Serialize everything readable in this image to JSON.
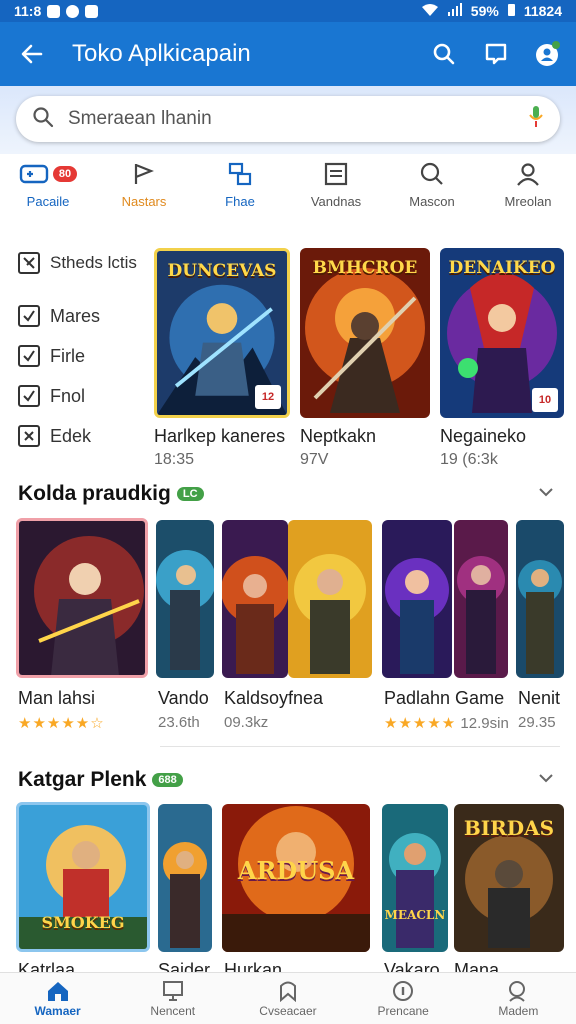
{
  "status": {
    "time": "11:8",
    "battery": "59%",
    "clock": "11824"
  },
  "appbar": {
    "title": "Toko Aplkicapain"
  },
  "search": {
    "placeholder": "Smeraean lhanin"
  },
  "categories": [
    {
      "label": "Pacaile",
      "badge": "80"
    },
    {
      "label": "Nastars"
    },
    {
      "label": "Fhae"
    },
    {
      "label": "Vandnas"
    },
    {
      "label": "Mascon"
    },
    {
      "label": "Mreolan"
    }
  ],
  "filters": {
    "heading": "Stheds lctis",
    "items": [
      "Mares",
      "Firle",
      "Fnol",
      "Edek"
    ]
  },
  "featured": [
    {
      "banner": "DUNCEVAS",
      "title": "Harlkep kaneres",
      "meta": "18:35",
      "badge": "12"
    },
    {
      "banner": "BMHCROE",
      "title": "Neptkakn",
      "meta": "97V",
      "badge": ""
    },
    {
      "banner": "DENAIKEO",
      "title": "Negaineko",
      "meta": "19 (6:3k",
      "badge": "10"
    }
  ],
  "section1": {
    "title": "Kolda praudkig",
    "pill": "LC",
    "items": [
      {
        "title": "Man lahsi",
        "stars": "★★★★★☆",
        "meta": ""
      },
      {
        "title": "Vando",
        "stars": "",
        "meta": "23.6th"
      },
      {
        "title": "Kaldsoyfnea",
        "stars": "",
        "meta": "09.3kz"
      },
      {
        "title": "Padlahn Game",
        "stars": "★★★★★",
        "meta": "12.9sin"
      },
      {
        "title": "Nenit",
        "stars": "",
        "meta": "29.35"
      }
    ]
  },
  "section2": {
    "title": "Katgar Plenk",
    "pill": "688",
    "items": [
      {
        "title": "Katrlaa",
        "banner": "SMOKEG"
      },
      {
        "title": "Saider",
        "banner": ""
      },
      {
        "title": "Hurkan",
        "banner": "ARDUSA"
      },
      {
        "title": "Vakaro",
        "banner": "MEACLN"
      },
      {
        "title": "Mana",
        "banner": "BIRDAS"
      }
    ]
  },
  "bottomnav": [
    {
      "label": "Wamaer"
    },
    {
      "label": "Nencent"
    },
    {
      "label": "Cvseacaer"
    },
    {
      "label": "Prencane"
    },
    {
      "label": "Madem"
    }
  ]
}
